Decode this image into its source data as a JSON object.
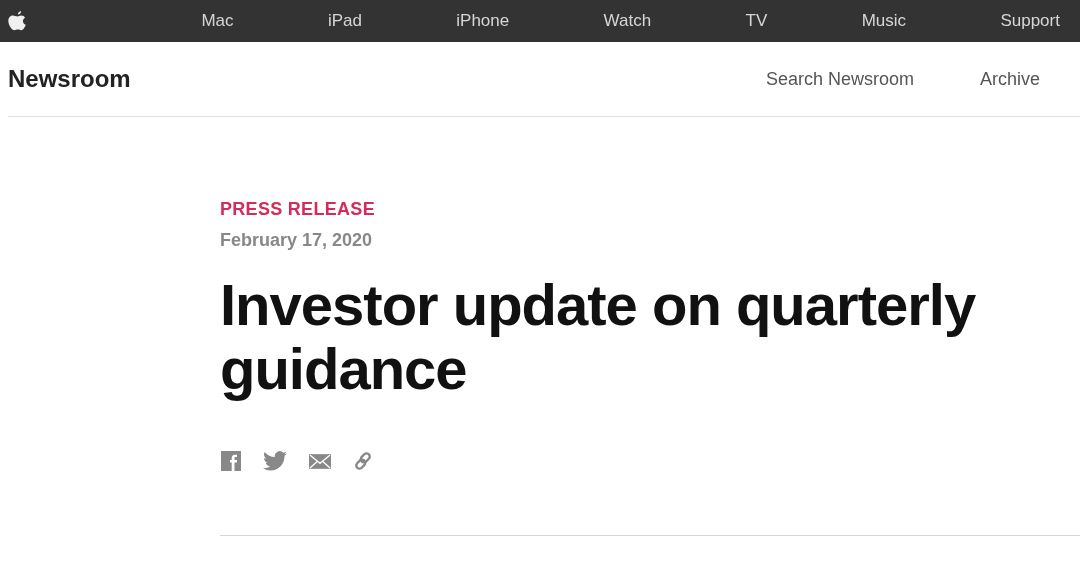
{
  "global_nav": {
    "items": [
      "Mac",
      "iPad",
      "iPhone",
      "Watch",
      "TV",
      "Music",
      "Support"
    ]
  },
  "local_nav": {
    "title": "Newsroom",
    "links": [
      "Search Newsroom",
      "Archive"
    ]
  },
  "article": {
    "category": "PRESS RELEASE",
    "date": "February 17, 2020",
    "headline": "Investor update on quarterly guidance",
    "share": [
      {
        "kind": "facebook"
      },
      {
        "kind": "twitter"
      },
      {
        "kind": "mail"
      },
      {
        "kind": "link"
      }
    ]
  }
}
